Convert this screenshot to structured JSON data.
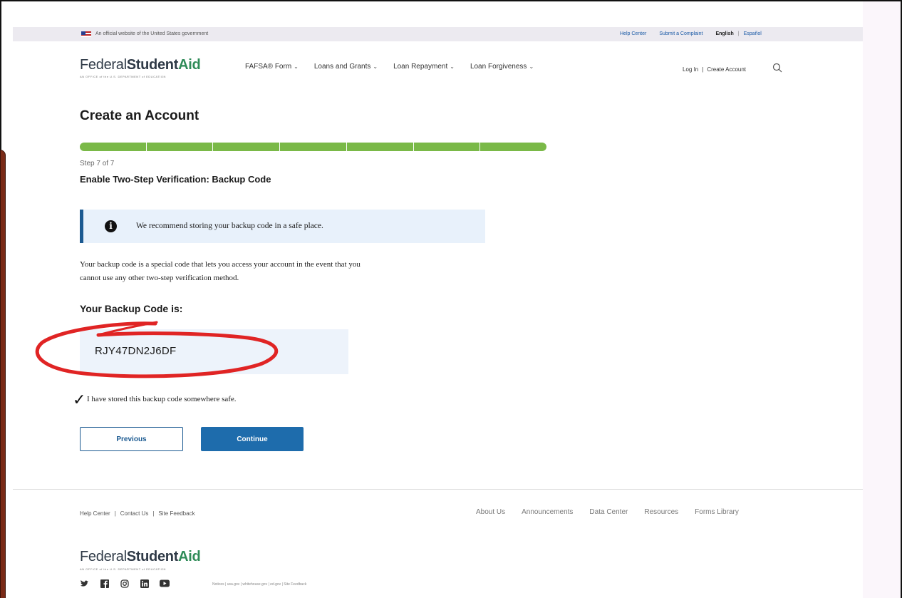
{
  "gov_banner": {
    "text": "An official website of the United States government",
    "help_center": "Help Center",
    "submit_complaint": "Submit a Complaint",
    "english": "English",
    "divider": "|",
    "espanol": "Español"
  },
  "header": {
    "logo_light": "Federal",
    "logo_bold": "Student",
    "logo_accent": "Aid",
    "logo_sub": "AN OFFICE of the U.S. DEPARTMENT of EDUCATION",
    "nav": [
      {
        "label": "FAFSA® Form"
      },
      {
        "label": "Loans and Grants"
      },
      {
        "label": "Loan Repayment"
      },
      {
        "label": "Loan Forgiveness"
      }
    ],
    "login": "Log In",
    "divider": "|",
    "create_account": "Create Account"
  },
  "main": {
    "title": "Create an Account",
    "step_label": "Step 7 of 7",
    "step_current": 7,
    "step_total": 7,
    "step_title": "Enable Two-Step Verification: Backup Code",
    "alert_text": "We recommend storing your backup code in a safe place.",
    "body_line1": "Your backup code is a special code that lets you access your account in the event that you",
    "body_line2": "cannot use any other two-step verification method.",
    "code_heading": "Your Backup Code is:",
    "code_value": "RJY47DN2J6DF",
    "check_label": "I have stored this backup code somewhere safe.",
    "previous_label": "Previous",
    "continue_label": "Continue"
  },
  "footer": {
    "help_center": "Help Center",
    "contact_us": "Contact Us",
    "site_feedback": "Site Feedback",
    "divider": "|",
    "links": [
      "About Us",
      "Announcements",
      "Data Center",
      "Resources",
      "Forms Library"
    ],
    "legal": "Notices | usa.gov | whitehouse.gov | ed.gov | Site Feedback"
  },
  "colors": {
    "progress": "#7ab948",
    "primary": "#1e6cac",
    "alert_bg": "#e8f1fb",
    "annotation": "#e02424"
  },
  "icons": {
    "search": "search-icon",
    "info": "info-icon",
    "check": "checkmark-icon",
    "social": [
      "twitter-icon",
      "facebook-icon",
      "instagram-icon",
      "linkedin-icon",
      "youtube-icon"
    ]
  }
}
